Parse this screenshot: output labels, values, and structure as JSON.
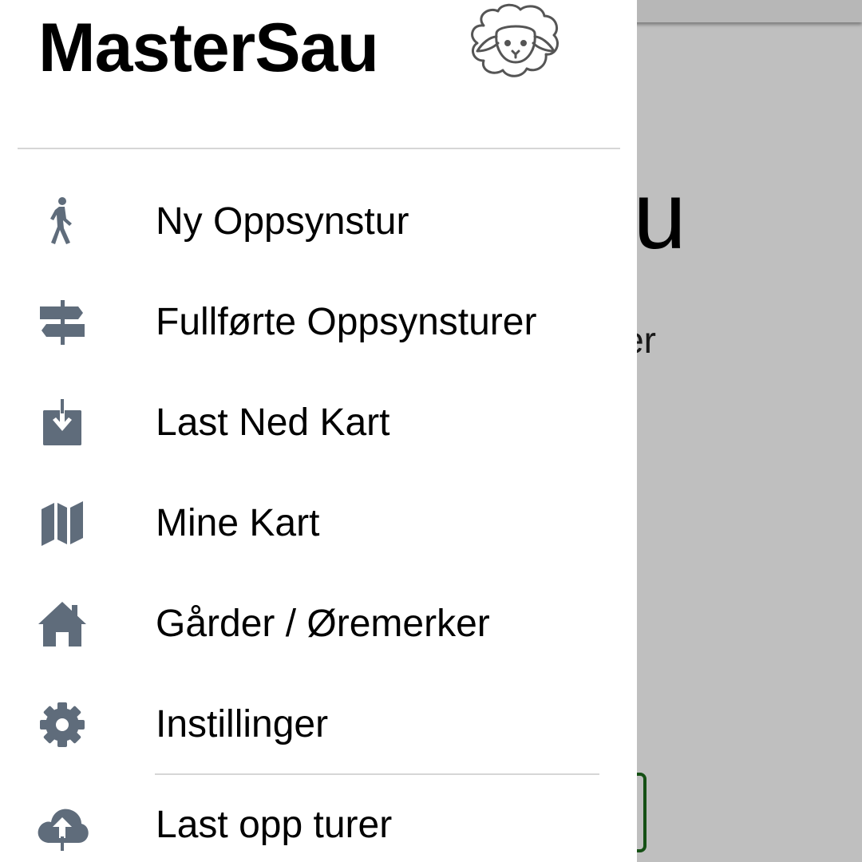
{
  "app": {
    "title": "MasterSau",
    "logo_icon": "sheep-icon"
  },
  "background": {
    "title_fragment": "u",
    "subtitle_fragment": "er"
  },
  "drawer": {
    "items": [
      {
        "label": "Ny Oppsynstur",
        "icon": "walking-person-icon"
      },
      {
        "label": "Fullførte Oppsynsturer",
        "icon": "signpost-icon"
      },
      {
        "label": "Last Ned Kart",
        "icon": "download-box-icon"
      },
      {
        "label": "Mine Kart",
        "icon": "map-icon"
      },
      {
        "label": "Gårder / Øremerker",
        "icon": "home-icon"
      },
      {
        "label": "Instillinger",
        "icon": "gear-icon"
      }
    ],
    "secondary_items": [
      {
        "label": "Last opp turer",
        "icon": "cloud-upload-icon"
      }
    ]
  },
  "colors": {
    "icon": "#5f6c7b",
    "divider": "#d6d6d6",
    "scrim": "rgba(0,0,0,0.25)",
    "bg_button_border": "#1c6b1c"
  }
}
